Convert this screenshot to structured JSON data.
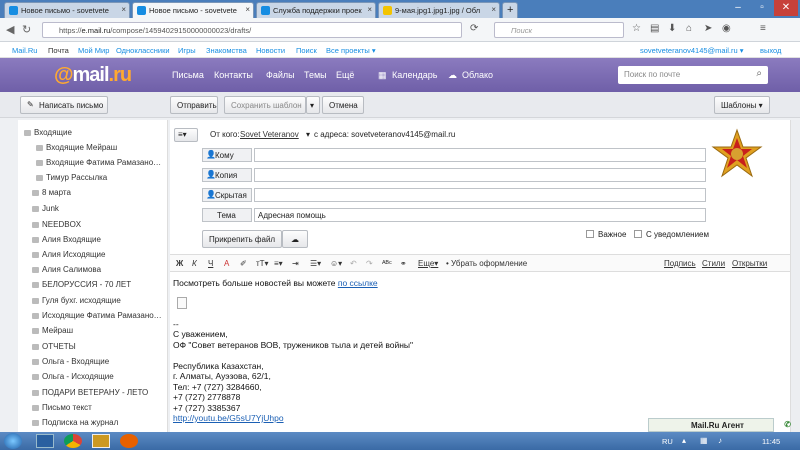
{
  "tabs": [
    {
      "label": "Новое письмо - sovetvete",
      "color": "#168de2"
    },
    {
      "label": "Новое письмо - sovetvete",
      "color": "#168de2"
    },
    {
      "label": "Служба поддержки проек",
      "color": "#168de2"
    },
    {
      "label": "9-мая.jpg1.jpg1.jpg / Обл",
      "color": "#f3c400"
    }
  ],
  "browser": {
    "url_prefix": "https://",
    "url_host": "e.mail.ru",
    "url_path": "/compose/14594029150000000023/drafts/",
    "search_placeholder": "Поиск"
  },
  "portal": {
    "links": [
      "Mail.Ru",
      "Почта",
      "Мой Мир",
      "Одноклассники",
      "Игры",
      "Знакомства",
      "Новости",
      "Поиск",
      "Все проекты ▾"
    ],
    "account": "sovetveteranov4145@mail.ru ▾",
    "logout": "выход"
  },
  "header": {
    "logo_at": "@",
    "logo_text": "mail",
    "logo_ru": ".ru",
    "nav": [
      "Письма",
      "Контакты",
      "Файлы",
      "Темы",
      "Ещё"
    ],
    "calendar": "Календарь",
    "cloud": "Облако",
    "search_placeholder": "Поиск по почте"
  },
  "toolbar": {
    "compose": "Написать письмо",
    "send": "Отправить",
    "save_template": "Сохранить шаблон",
    "cancel": "Отмена",
    "templates": "Шаблоны ▾"
  },
  "folders": [
    "Входящие",
    "Входящие Мейраш",
    "Входящие Фатима Рамазано…",
    "Тимур Рассылка",
    "8 марта",
    "Junk",
    "NEEDBOX",
    "Алия Входящие",
    "Алия Исходящие",
    "Алия Салимова",
    "БЕЛОРУССИЯ - 70 ЛЕТ",
    "Гуля бухг. исходящие",
    "Исходящие Фатима Рамазано…",
    "Мейраш",
    "ОТЧЕТЫ",
    "Ольга - Входящие",
    "Ольга - Исходящие",
    "ПОДАРИ ВЕТЕРАНУ - ЛЕТО",
    "Письмо текст",
    "Подписка на журнал"
  ],
  "compose": {
    "from_label": "От кого:",
    "from_name": "Sovet Veteranov",
    "from_addr_label": "с адреса: sovetveteranov4145@mail.ru",
    "to": "Кому",
    "cc": "Копия",
    "bcc": "Скрытая",
    "subject_label": "Тема",
    "subject": "Адресная помощь",
    "attach": "Прикрепить файл",
    "important": "Важное",
    "notify": "С уведомлением"
  },
  "editor": {
    "more": "Еще▾",
    "remove_format": "• Убрать оформление",
    "signature": "Подпись",
    "styles": "Стили",
    "cards": "Открытки"
  },
  "body": {
    "line1": "Посмотреть больше новостей вы можете ",
    "link1": "по ссылке",
    "sig": [
      "--",
      "С уважением,",
      "ОФ \"Совет ветеранов ВОВ, тружеников тыла и детей войны\"",
      "",
      "Республика Казахстан,",
      "г. Алматы, Ауэзова, 62/1,",
      "Тел: +7 (727) 3284660,",
      "+7 (727) 2778878",
      "+7 (727) 3385367"
    ],
    "link2": "http://youtu.be/G5sU7YjUhpo"
  },
  "agent": "Mail.Ru Агент",
  "taskbar": {
    "lang": "RU",
    "time": "11:45"
  }
}
